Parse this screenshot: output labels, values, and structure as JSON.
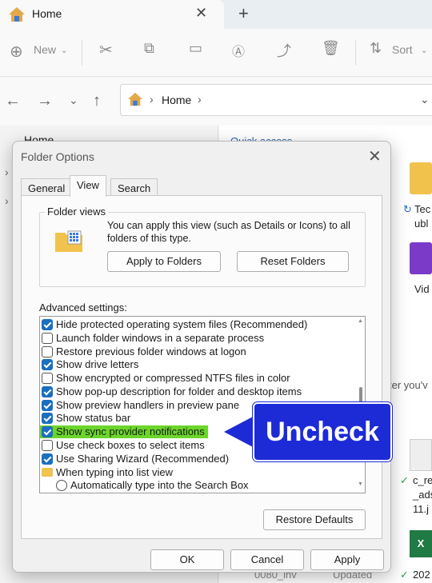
{
  "tab": {
    "title": "Home",
    "close": "✕",
    "newtab": "+"
  },
  "toolbar": {
    "new_label": "New",
    "sort_label": "Sort"
  },
  "address": {
    "crumb": "Home"
  },
  "navpane": {
    "home": "Home"
  },
  "content": {
    "quick_access": "Quick access",
    "items": {
      "tec": "Tec",
      "ubl": "ubl",
      "vid": "Vid",
      "tip": "ter you'v",
      "file1_a": "c_re",
      "file1_b": "_ads",
      "file1_c": "11.j",
      "file2": "202",
      "bottom_left": "0080_inv",
      "bottom_mid": "Updated"
    }
  },
  "dialog": {
    "title": "Folder Options",
    "close": "✕",
    "tabs": [
      "General",
      "View",
      "Search"
    ],
    "folder_views": {
      "label": "Folder views",
      "description": "You can apply this view (such as Details or Icons) to all folders of this type.",
      "apply_button": "Apply to Folders",
      "reset_button": "Reset Folders"
    },
    "advanced_label": "Advanced settings:",
    "settings": [
      {
        "label": "Hide protected operating system files (Recommended)",
        "type": "checkbox",
        "checked": true
      },
      {
        "label": "Launch folder windows in a separate process",
        "type": "checkbox",
        "checked": false
      },
      {
        "label": "Restore previous folder windows at logon",
        "type": "checkbox",
        "checked": false
      },
      {
        "label": "Show drive letters",
        "type": "checkbox",
        "checked": true
      },
      {
        "label": "Show encrypted or compressed NTFS files in color",
        "type": "checkbox",
        "checked": false
      },
      {
        "label": "Show pop-up description for folder and desktop items",
        "type": "checkbox",
        "checked": true
      },
      {
        "label": "Show preview handlers in preview pane",
        "type": "checkbox",
        "checked": true
      },
      {
        "label": "Show status bar",
        "type": "checkbox",
        "checked": true
      },
      {
        "label": "Show sync provider notifications",
        "type": "checkbox",
        "checked": true,
        "highlighted": true
      },
      {
        "label": "Use check boxes to select items",
        "type": "checkbox",
        "checked": false
      },
      {
        "label": "Use Sharing Wizard (Recommended)",
        "type": "checkbox",
        "checked": true
      },
      {
        "label": "When typing into list view",
        "type": "folder"
      },
      {
        "label": "Automatically type into the Search Box",
        "type": "radio",
        "checked": false
      }
    ],
    "restore_defaults": "Restore Defaults",
    "ok": "OK",
    "cancel": "Cancel",
    "apply": "Apply"
  },
  "callout": {
    "text": "Uncheck",
    "color": "#1d2bd6",
    "highlight_color": "#6bd52b"
  }
}
